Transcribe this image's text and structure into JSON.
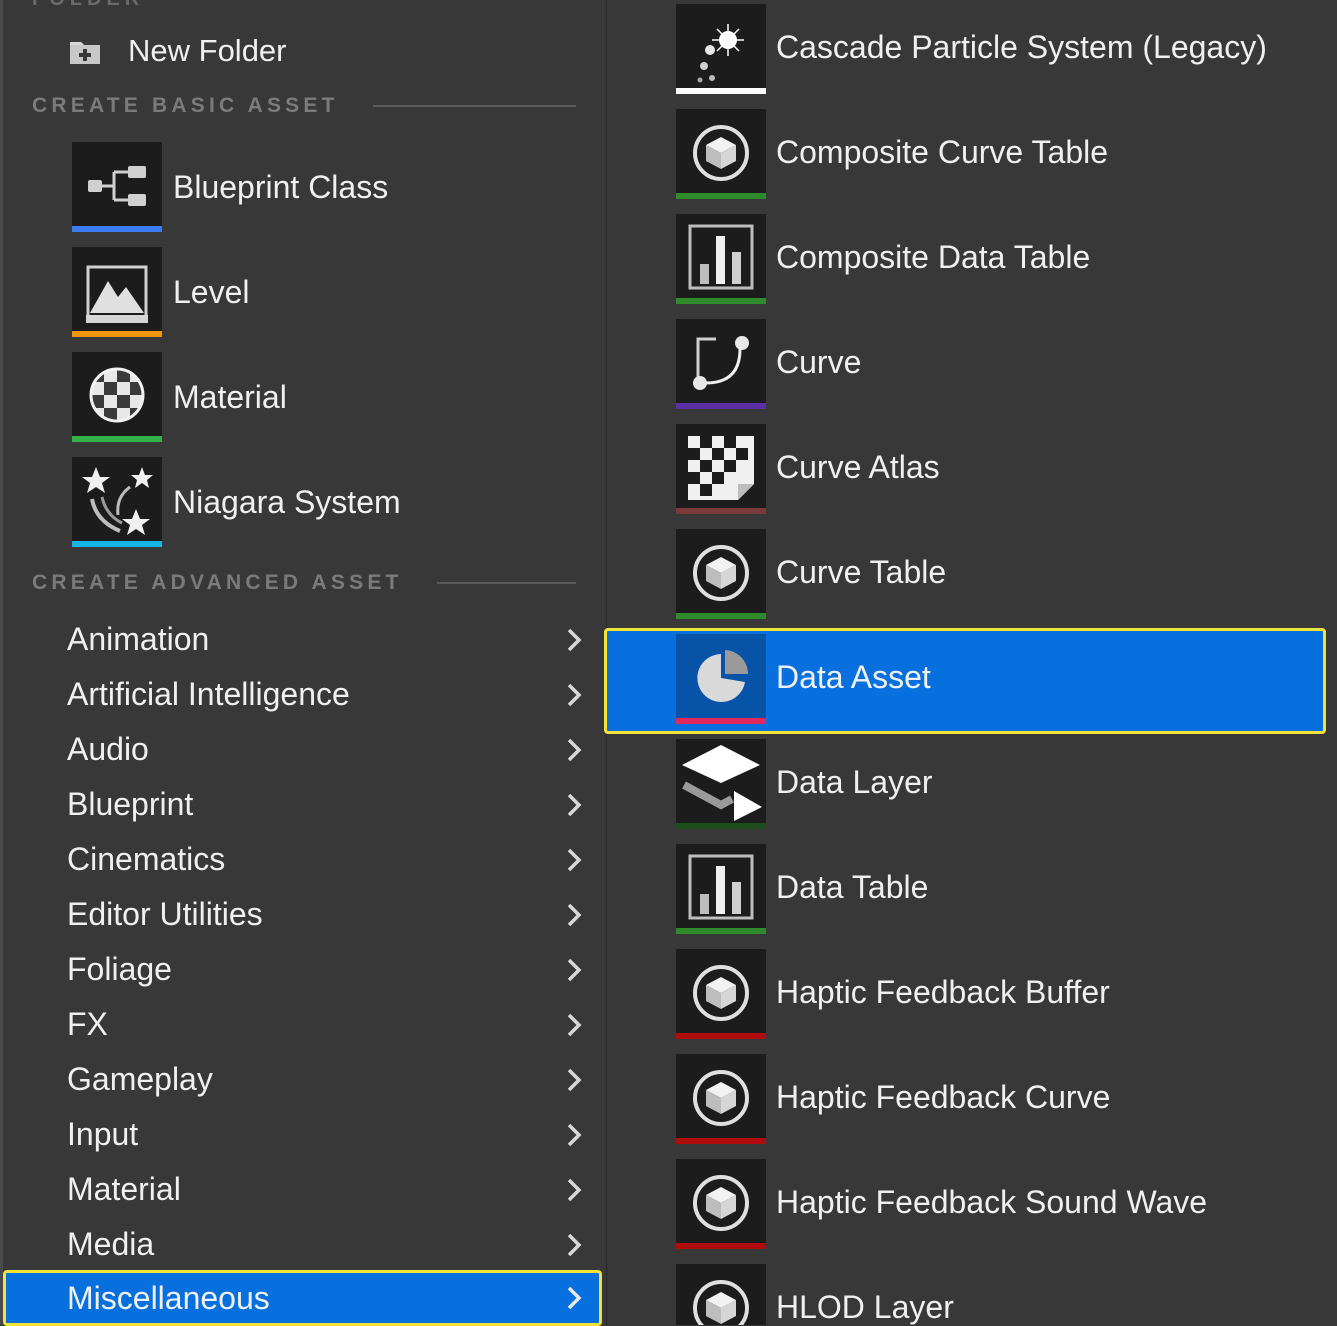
{
  "left_menu": {
    "top_ghost_label": "FOLDER",
    "new_folder_label": "New Folder",
    "basic_section_label": "CREATE BASIC ASSET",
    "advanced_section_label": "CREATE ADVANCED ASSET",
    "basic_items": [
      {
        "label": "Blueprint Class",
        "icon": "blueprint-class-icon",
        "color": "#3d7cf0"
      },
      {
        "label": "Level",
        "icon": "level-icon",
        "color": "#f0960a"
      },
      {
        "label": "Material",
        "icon": "material-icon",
        "color": "#33b14a"
      },
      {
        "label": "Niagara System",
        "icon": "niagara-system-icon",
        "color": "#12b6e8"
      }
    ],
    "categories": [
      {
        "label": "Animation"
      },
      {
        "label": "Artificial Intelligence"
      },
      {
        "label": "Audio"
      },
      {
        "label": "Blueprint"
      },
      {
        "label": "Cinematics"
      },
      {
        "label": "Editor Utilities"
      },
      {
        "label": "Foliage"
      },
      {
        "label": "FX"
      },
      {
        "label": "Gameplay"
      },
      {
        "label": "Input"
      },
      {
        "label": "Material"
      },
      {
        "label": "Media"
      },
      {
        "label": "Miscellaneous",
        "selected": true
      }
    ]
  },
  "submenu": {
    "items": [
      {
        "label": "Cascade Particle System (Legacy)",
        "icon": "cascade-particle-icon",
        "color": "#ffffff"
      },
      {
        "label": "Composite Curve Table",
        "icon": "cube-icon",
        "color": "#2f8a2b"
      },
      {
        "label": "Composite Data Table",
        "icon": "bar-chart-icon",
        "color": "#2f8a2b"
      },
      {
        "label": "Curve",
        "icon": "curve-icon",
        "color": "#5a2fa3"
      },
      {
        "label": "Curve Atlas",
        "icon": "checker-atlas-icon",
        "color": "#7a3a3a"
      },
      {
        "label": "Curve Table",
        "icon": "cube-icon",
        "color": "#2f8a2b"
      },
      {
        "label": "Data Asset",
        "icon": "pie-chart-icon",
        "color": "#e2295d",
        "selected": true
      },
      {
        "label": "Data Layer",
        "icon": "data-layer-icon",
        "color": "#1b4d1b"
      },
      {
        "label": "Data Table",
        "icon": "bar-chart-icon",
        "color": "#2f8a2b"
      },
      {
        "label": "Haptic Feedback Buffer",
        "icon": "cube-icon",
        "color": "#b00c0c"
      },
      {
        "label": "Haptic Feedback Curve",
        "icon": "cube-icon",
        "color": "#b00c0c"
      },
      {
        "label": "Haptic Feedback Sound Wave",
        "icon": "cube-icon",
        "color": "#b00c0c"
      },
      {
        "label": "HLOD Layer",
        "icon": "cube-icon",
        "color": "#b00c0c"
      }
    ]
  }
}
